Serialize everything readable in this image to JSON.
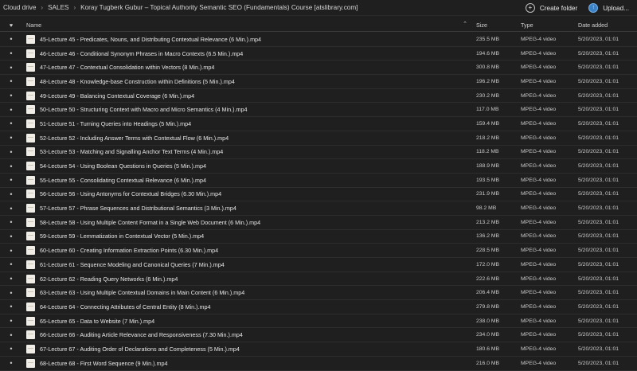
{
  "breadcrumb": [
    "Cloud drive",
    "SALES",
    "Koray Tugberk Gubur – Topical Authority Semantic SEO (Fundamentals) Course [atslibrary.com]"
  ],
  "actions": {
    "create_folder": "Create folder",
    "upload": "Upload..."
  },
  "columns": {
    "name": "Name",
    "size": "Size",
    "type": "Type",
    "date": "Date added"
  },
  "rows": [
    {
      "name": "45-Lecture 45 - Predicates, Nouns, and Distributing Contextual Relevance (6 Min.).mp4",
      "size": "235.5 MB",
      "type": "MPEG-4 video",
      "date": "5/20/2023, 01:01"
    },
    {
      "name": "46-Lecture 46 - Conditional Synonym Phrases in Macro Contexts (6.5 Min.).mp4",
      "size": "194.6 MB",
      "type": "MPEG-4 video",
      "date": "5/20/2023, 01:01"
    },
    {
      "name": "47-Lecture 47 - Contextual Consolidation within Vectors (8 Min.).mp4",
      "size": "300.8 MB",
      "type": "MPEG-4 video",
      "date": "5/20/2023, 01:01"
    },
    {
      "name": "48-Lecture 48 - Knowledge-base Construction within Definitions (5 Min.).mp4",
      "size": "196.2 MB",
      "type": "MPEG-4 video",
      "date": "5/20/2023, 01:01"
    },
    {
      "name": "49-Lecture 49 - Balancing Contextual Coverage (6 Min.).mp4",
      "size": "230.2 MB",
      "type": "MPEG-4 video",
      "date": "5/20/2023, 01:01"
    },
    {
      "name": "50-Lecture 50 - Structuring Context with Macro and Micro Semantics (4 Min.).mp4",
      "size": "117.0 MB",
      "type": "MPEG-4 video",
      "date": "5/20/2023, 01:01"
    },
    {
      "name": "51-Lecture 51 - Turning Queries into Headings (5 Min.).mp4",
      "size": "159.4 MB",
      "type": "MPEG-4 video",
      "date": "5/20/2023, 01:01"
    },
    {
      "name": "52-Lecture 52 - Including Answer Terms with Contextual Flow (6 Min.).mp4",
      "size": "218.2 MB",
      "type": "MPEG-4 video",
      "date": "5/20/2023, 01:01"
    },
    {
      "name": "53-Lecture 53 - Matching and Signalling Anchor Text Terms (4 Min.).mp4",
      "size": "118.2 MB",
      "type": "MPEG-4 video",
      "date": "5/20/2023, 01:01"
    },
    {
      "name": "54-Lecture 54 - Using Boolean Questions in Queries (5 Min.).mp4",
      "size": "188.9 MB",
      "type": "MPEG-4 video",
      "date": "5/20/2023, 01:01"
    },
    {
      "name": "55-Lecture 55 - Consolidating Contextual Relevance (6 Min.).mp4",
      "size": "193.5 MB",
      "type": "MPEG-4 video",
      "date": "5/20/2023, 01:01"
    },
    {
      "name": "56-Lecture 56 - Using Antonyms for Contextual Bridges (6.30 Min.).mp4",
      "size": "231.9 MB",
      "type": "MPEG-4 video",
      "date": "5/20/2023, 01:01"
    },
    {
      "name": "57-Lecture 57 - Phrase Sequences and Distributional Semantics (3 Min.).mp4",
      "size": "98.2 MB",
      "type": "MPEG-4 video",
      "date": "5/20/2023, 01:01"
    },
    {
      "name": "58-Lecture 58 - Using Multiple Content Format in a Single Web Document (6 Min.).mp4",
      "size": "213.2 MB",
      "type": "MPEG-4 video",
      "date": "5/20/2023, 01:01"
    },
    {
      "name": "59-Lecture 59 - Lemmatization in Contextual Vector (5 Min.).mp4",
      "size": "136.2 MB",
      "type": "MPEG-4 video",
      "date": "5/20/2023, 01:01"
    },
    {
      "name": "60-Lecture 60 - Creating Information Extraction Points (6.30 Min.).mp4",
      "size": "228.5 MB",
      "type": "MPEG-4 video",
      "date": "5/20/2023, 01:01"
    },
    {
      "name": "61-Lecture 61 - Sequence Modeling and Canonical Queries (7 Min.).mp4",
      "size": "172.0 MB",
      "type": "MPEG-4 video",
      "date": "5/20/2023, 01:01"
    },
    {
      "name": "62-Lecture 62 - Reading Query Networks (6 Min.).mp4",
      "size": "222.6 MB",
      "type": "MPEG-4 video",
      "date": "5/20/2023, 01:01"
    },
    {
      "name": "63-Lecture 63 - Using Multiple Contextual Domains in Main Content (6 Min.).mp4",
      "size": "206.4 MB",
      "type": "MPEG-4 video",
      "date": "5/20/2023, 01:01"
    },
    {
      "name": "64-Lecture 64 - Connecting Attributes of Central Entity (8 Min.).mp4",
      "size": "279.8 MB",
      "type": "MPEG-4 video",
      "date": "5/20/2023, 01:01"
    },
    {
      "name": "65-Lecture 65 - Data to Website (7 Min.).mp4",
      "size": "238.0 MB",
      "type": "MPEG-4 video",
      "date": "5/20/2023, 01:01"
    },
    {
      "name": "66-Lecture 66 - Auditing Article Relevance and Responsiveness (7.30 Min.).mp4",
      "size": "234.0 MB",
      "type": "MPEG-4 video",
      "date": "5/20/2023, 01:01"
    },
    {
      "name": "67-Lecture 67 - Auditing Order of Declarations and Completeness (5 Min.).mp4",
      "size": "180.6 MB",
      "type": "MPEG-4 video",
      "date": "5/20/2023, 01:01"
    },
    {
      "name": "68-Lecture 68 - First Word Sequence (9 Min.).mp4",
      "size": "216.0 MB",
      "type": "MPEG-4 video",
      "date": "5/20/2023, 01:01"
    }
  ]
}
